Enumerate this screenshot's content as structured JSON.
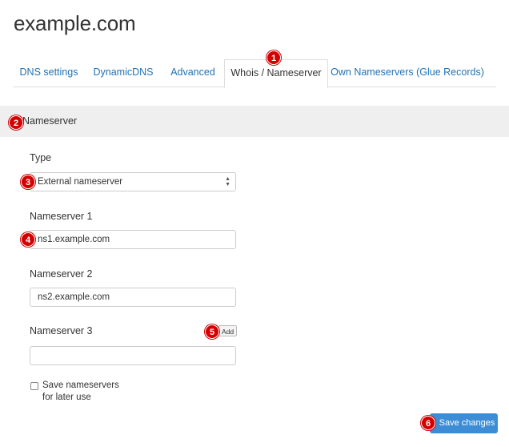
{
  "page": {
    "title": "example.com"
  },
  "tabs": [
    {
      "label": "DNS settings"
    },
    {
      "label": "DynamicDNS"
    },
    {
      "label": "Advanced"
    },
    {
      "label": "Whois / Nameserver"
    },
    {
      "label": "Own Nameservers (Glue Records)"
    }
  ],
  "active_tab": "Whois / Nameserver",
  "section": {
    "title": "Nameserver"
  },
  "form": {
    "type_label": "Type",
    "type_value": "External nameserver",
    "ns1_label": "Nameserver 1",
    "ns1_value": "ns1.example.com",
    "ns2_label": "Nameserver 2",
    "ns2_value": "ns2.example.com",
    "ns3_label": "Nameserver 3",
    "ns3_value": "",
    "add_label": "Add",
    "save_checkbox_label_line1": "Save nameservers",
    "save_checkbox_label_line2": "for later use",
    "save_checkbox_checked": false,
    "save_button_label": "Save changes"
  },
  "markers": [
    "1",
    "2",
    "3",
    "4",
    "5",
    "6"
  ],
  "colors": {
    "link": "#1f73b7",
    "primary_button": "#3c8dd6",
    "marker": "#d40000",
    "section_bg": "#efefef"
  }
}
